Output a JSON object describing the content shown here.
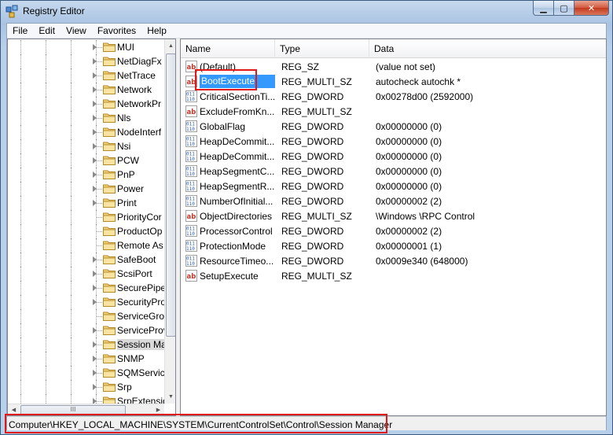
{
  "window": {
    "title": "Registry Editor",
    "minimize_glyph": "▁",
    "maximize_glyph": "▢",
    "close_glyph": "✕"
  },
  "menu": [
    "File",
    "Edit",
    "View",
    "Favorites",
    "Help"
  ],
  "tree": {
    "items": [
      {
        "label": "MUI",
        "expandable": true
      },
      {
        "label": "NetDiagFx",
        "expandable": true
      },
      {
        "label": "NetTrace",
        "expandable": true
      },
      {
        "label": "Network",
        "expandable": true
      },
      {
        "label": "NetworkPr",
        "expandable": true
      },
      {
        "label": "Nls",
        "expandable": true
      },
      {
        "label": "NodeInterf",
        "expandable": true
      },
      {
        "label": "Nsi",
        "expandable": true
      },
      {
        "label": "PCW",
        "expandable": true
      },
      {
        "label": "PnP",
        "expandable": true
      },
      {
        "label": "Power",
        "expandable": true
      },
      {
        "label": "Print",
        "expandable": true
      },
      {
        "label": "PriorityCor",
        "expandable": false
      },
      {
        "label": "ProductOp",
        "expandable": false
      },
      {
        "label": "Remote As",
        "expandable": false
      },
      {
        "label": "SafeBoot",
        "expandable": true
      },
      {
        "label": "ScsiPort",
        "expandable": true
      },
      {
        "label": "SecurePipe",
        "expandable": true
      },
      {
        "label": "SecurityPro",
        "expandable": true
      },
      {
        "label": "ServiceGro",
        "expandable": false
      },
      {
        "label": "ServiceProv",
        "expandable": true
      },
      {
        "label": "Session Ma",
        "expandable": true,
        "selected": true
      },
      {
        "label": "SNMP",
        "expandable": true
      },
      {
        "label": "SQMServic",
        "expandable": true
      },
      {
        "label": "Srp",
        "expandable": true
      },
      {
        "label": "SrpExtensio",
        "expandable": true
      }
    ],
    "hscroll_grip": "III"
  },
  "columns": {
    "name": "Name",
    "type": "Type",
    "data": "Data"
  },
  "values": [
    {
      "name": "(Default)",
      "type": "REG_SZ",
      "data": "(value not set)",
      "kind": "sz"
    },
    {
      "name": "BootExecute",
      "type": "REG_MULTI_SZ",
      "data": "autocheck autochk *",
      "kind": "sz",
      "selected": true
    },
    {
      "name": "CriticalSectionTi...",
      "type": "REG_DWORD",
      "data": "0x00278d00 (2592000)",
      "kind": "bin"
    },
    {
      "name": "ExcludeFromKn...",
      "type": "REG_MULTI_SZ",
      "data": "",
      "kind": "sz"
    },
    {
      "name": "GlobalFlag",
      "type": "REG_DWORD",
      "data": "0x00000000 (0)",
      "kind": "bin"
    },
    {
      "name": "HeapDeCommit...",
      "type": "REG_DWORD",
      "data": "0x00000000 (0)",
      "kind": "bin"
    },
    {
      "name": "HeapDeCommit...",
      "type": "REG_DWORD",
      "data": "0x00000000 (0)",
      "kind": "bin"
    },
    {
      "name": "HeapSegmentC...",
      "type": "REG_DWORD",
      "data": "0x00000000 (0)",
      "kind": "bin"
    },
    {
      "name": "HeapSegmentR...",
      "type": "REG_DWORD",
      "data": "0x00000000 (0)",
      "kind": "bin"
    },
    {
      "name": "NumberOfInitial...",
      "type": "REG_DWORD",
      "data": "0x00000002 (2)",
      "kind": "bin"
    },
    {
      "name": "ObjectDirectories",
      "type": "REG_MULTI_SZ",
      "data": "\\Windows \\RPC Control",
      "kind": "sz"
    },
    {
      "name": "ProcessorControl",
      "type": "REG_DWORD",
      "data": "0x00000002 (2)",
      "kind": "bin"
    },
    {
      "name": "ProtectionMode",
      "type": "REG_DWORD",
      "data": "0x00000001 (1)",
      "kind": "bin"
    },
    {
      "name": "ResourceTimeo...",
      "type": "REG_DWORD",
      "data": "0x0009e340 (648000)",
      "kind": "bin"
    },
    {
      "name": "SetupExecute",
      "type": "REG_MULTI_SZ",
      "data": "",
      "kind": "sz"
    }
  ],
  "statusbar": {
    "path": "Computer\\HKEY_LOCAL_MACHINE\\SYSTEM\\CurrentControlSet\\Control\\Session Manager"
  },
  "colors": {
    "selection": "#3399ff",
    "highlight_box": "#e01818",
    "string_icon": "#c0392b",
    "binary_icon": "#2a5db0"
  }
}
